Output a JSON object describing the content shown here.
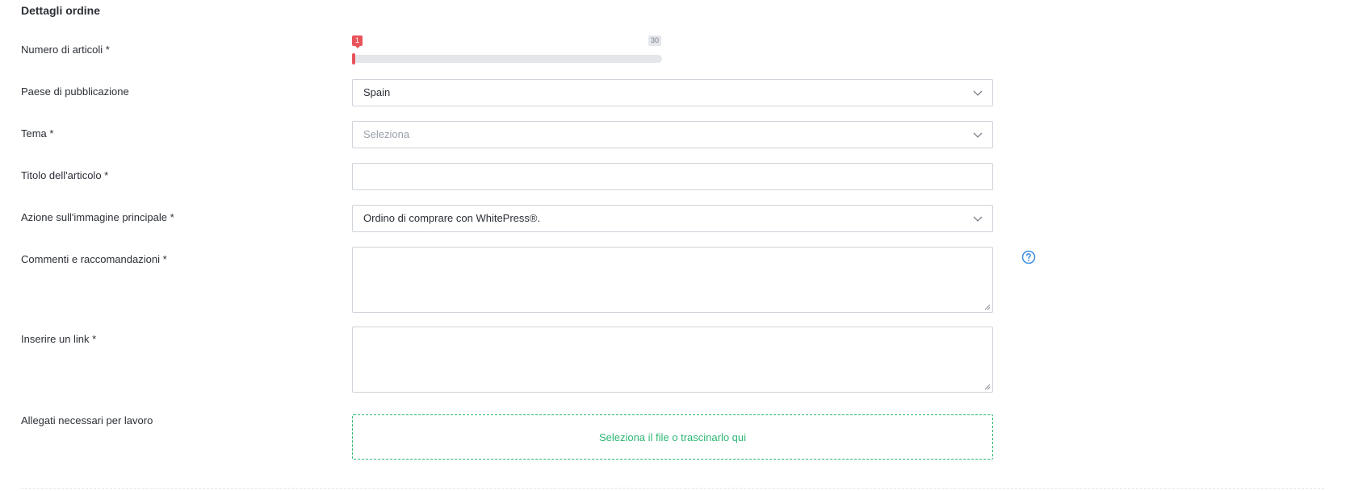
{
  "section": {
    "title": "Dettagli ordine"
  },
  "fields": {
    "articles": {
      "label": "Numero di articoli *",
      "min_label": "1",
      "max_label": "30",
      "value": 1,
      "min": 1,
      "max": 30
    },
    "country": {
      "label": "Paese di pubblicazione",
      "value": "Spain"
    },
    "topic": {
      "label": "Tema *",
      "placeholder": "Seleziona"
    },
    "article_title": {
      "label": "Titolo dell'articolo *",
      "value": ""
    },
    "main_image": {
      "label": "Azione sull'immagine principale *",
      "value": "Ordino di comprare con WhitePress®."
    },
    "comments": {
      "label": "Commenti e raccomandazioni *",
      "value": ""
    },
    "link": {
      "label": "Inserire un link *",
      "value": ""
    },
    "attachments": {
      "label": "Allegati necessari per lavoro",
      "dropzone_text": "Seleziona il file o trascinarlo qui"
    }
  },
  "icons": {
    "select_arrow": "chevron-down-icon",
    "help": "question-circle-icon",
    "resize": "resize-grip-icon"
  },
  "colors": {
    "accent_red": "#e9535a",
    "accent_green": "#2bb673",
    "help_blue": "#3d8fe0",
    "border": "#cfd3da"
  }
}
